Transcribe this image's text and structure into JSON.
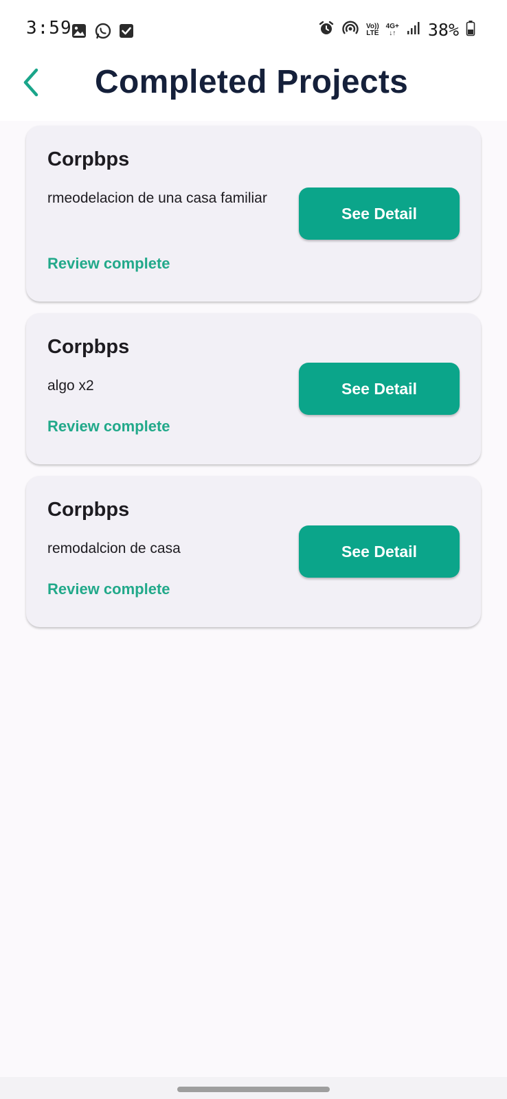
{
  "status_bar": {
    "time": "3:59",
    "left_icons": [
      "gallery-icon",
      "whatsapp-icon",
      "checkbox-icon"
    ],
    "right_icons": [
      "alarm-icon",
      "hotspot-icon",
      "volte-icon",
      "network-4g-icon",
      "signal-icon",
      "battery-icon"
    ],
    "volte_label_top": "Vo))",
    "volte_label_bottom": "LTE",
    "network_label": "4G+",
    "battery_percent": "38%"
  },
  "app_bar": {
    "title": "Completed Projects",
    "back_icon": "chevron-left-icon",
    "accent_color": "#1aa58a"
  },
  "projects": [
    {
      "title": "Corpbps",
      "description": "rmeodelacion de una casa familiar",
      "status": "Review complete",
      "button_label": "See Detail"
    },
    {
      "title": "Corpbps",
      "description": "algo x2",
      "status": "Review complete",
      "button_label": "See Detail"
    },
    {
      "title": "Corpbps",
      "description": "remodalcion de casa",
      "status": "Review complete",
      "button_label": "See Detail"
    }
  ],
  "colors": {
    "button": "#0ba58a",
    "status_text": "#22a98a",
    "card_bg": "#f2f0f6",
    "title": "#15203a"
  }
}
